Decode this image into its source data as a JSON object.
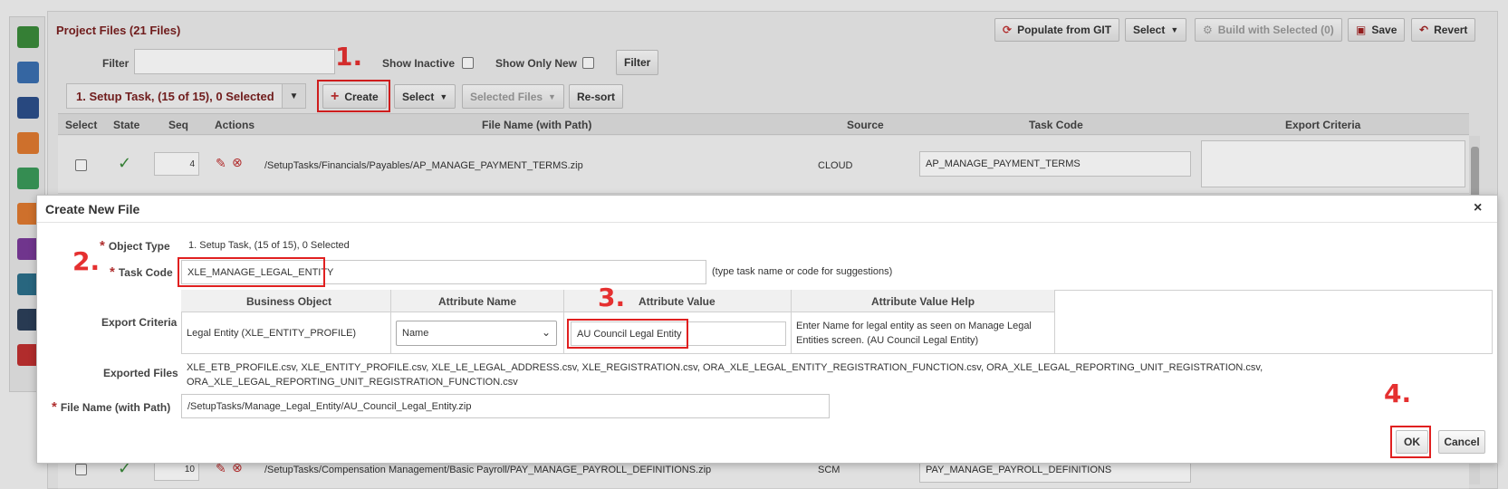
{
  "header": {
    "title": "Project Files (21 Files)",
    "buttons": {
      "populate": "Populate from GIT",
      "select": "Select",
      "build": "Build with Selected (0)",
      "save": "Save",
      "revert": "Revert"
    }
  },
  "filter": {
    "label": "Filter",
    "value": "",
    "show_inactive": "Show Inactive",
    "show_only_new": "Show Only New",
    "button": "Filter"
  },
  "toolbar": {
    "task_select": "1. Setup Task, (15 of 15), 0 Selected",
    "create": "Create",
    "select": "Select",
    "selected_files": "Selected Files",
    "resort": "Re-sort"
  },
  "grid": {
    "columns": [
      "Select",
      "State",
      "Seq",
      "Actions",
      "File Name (with Path)",
      "Source",
      "Task Code",
      "Export Criteria"
    ],
    "rows": [
      {
        "seq": "4",
        "file": "/SetupTasks/Financials/Payables/AP_MANAGE_PAYMENT_TERMS.zip",
        "source": "CLOUD",
        "task_code": "AP_MANAGE_PAYMENT_TERMS"
      },
      {
        "seq": "10",
        "file": "/SetupTasks/Compensation Management/Basic Payroll/PAY_MANAGE_PAYROLL_DEFINITIONS.zip",
        "source": "SCM",
        "task_code": "PAY_MANAGE_PAYROLL_DEFINITIONS"
      }
    ]
  },
  "annotations": {
    "step1": "1.",
    "step2": "2.",
    "step3": "3.",
    "step4": "4."
  },
  "dialog": {
    "title": "Create New File",
    "object_type_label": "Object Type",
    "object_type_value": "1. Setup Task, (15 of 15), 0 Selected",
    "task_code_label": "Task Code",
    "task_code_value": "XLE_MANAGE_LEGAL_ENTITY",
    "task_code_hint": "(type task name or code for suggestions)",
    "export_criteria_label": "Export Criteria",
    "criteria_columns": [
      "Business Object",
      "Attribute Name",
      "Attribute Value",
      "Attribute Value Help"
    ],
    "criteria_row": {
      "business_object": "Legal Entity (XLE_ENTITY_PROFILE)",
      "attribute_name": "Name",
      "attribute_value": "AU Council Legal Entity",
      "help_line1": "Enter Name for legal entity as seen on Manage Legal",
      "help_line2": "Entities screen. (AU Council Legal Entity)"
    },
    "exported_files_label": "Exported Files",
    "exported_files_line1": "XLE_ETB_PROFILE.csv, XLE_ENTITY_PROFILE.csv, XLE_LE_LEGAL_ADDRESS.csv, XLE_REGISTRATION.csv, ORA_XLE_LEGAL_ENTITY_REGISTRATION_FUNCTION.csv, ORA_XLE_LEGAL_REPORTING_UNIT_REGISTRATION.csv,",
    "exported_files_line2": "ORA_XLE_LEGAL_REPORTING_UNIT_REGISTRATION_FUNCTION.csv",
    "file_name_label": "File Name (with Path)",
    "file_name_value": "/SetupTasks/Manage_Legal_Entity/AU_Council_Legal_Entity.zip",
    "ok": "OK",
    "cancel": "Cancel",
    "close": "×"
  },
  "icons": {
    "accent": "#e53030",
    "title_color": "#7a2020"
  }
}
